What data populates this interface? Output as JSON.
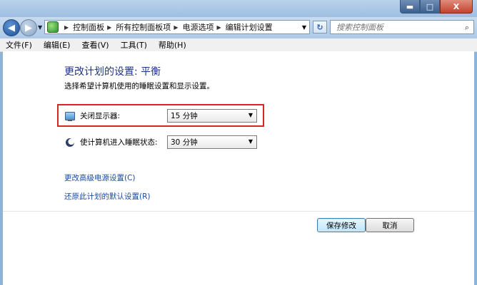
{
  "window": {
    "controls": {
      "minimize": "▬",
      "maximize": "□",
      "close": "X"
    }
  },
  "nav": {
    "breadcrumbs": [
      "控制面板",
      "所有控制面板项",
      "电源选项",
      "编辑计划设置"
    ],
    "search_placeholder": "搜索控制面板",
    "refresh_glyph": "↻"
  },
  "menu": [
    "文件(F)",
    "编辑(E)",
    "查看(V)",
    "工具(T)",
    "帮助(H)"
  ],
  "page": {
    "heading": "更改计划的设置: 平衡",
    "subtitle": "选择希望计算机使用的睡眠设置和显示设置。",
    "display": {
      "label": "关闭显示器:",
      "value": "15 分钟"
    },
    "sleep": {
      "label": "使计算机进入睡眠状态:",
      "value": "30 分钟"
    },
    "link_advanced": "更改高级电源设置(C)",
    "link_restore": "还原此计划的默认设置(R)",
    "save_label": "保存修改",
    "cancel_label": "取消"
  },
  "colors": {
    "highlight": "#d4262b",
    "link": "#1a4aa0",
    "heading": "#1e3287"
  }
}
